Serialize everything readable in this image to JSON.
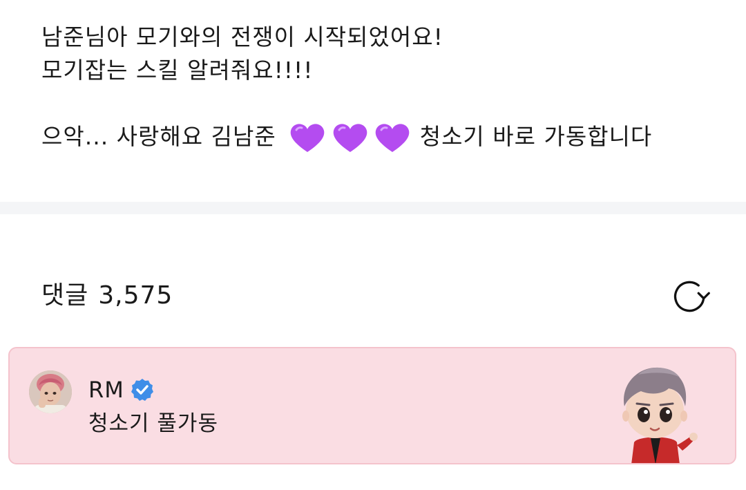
{
  "post": {
    "lines": [
      "남준님아 모기와의 전쟁이 시작되었어요!",
      "모기잡는 스킬 알려줘요!!!!"
    ],
    "line3_before": "으악... 사랑해요 김남준",
    "line3_after": "청소기 바로 가동합니다",
    "hearts_icon": "purple-heart-emoji",
    "hearts_color": "#b44cf0"
  },
  "comments": {
    "label": "댓글",
    "count": "3,575",
    "refresh_icon": "refresh-icon"
  },
  "pinned_comment": {
    "author": "RM",
    "verified_icon": "verified-badge-icon",
    "verified_color": "#3f8ee8",
    "text": "청소기 풀가동",
    "background": "#fadde3",
    "sticker_icon": "character-sticker"
  }
}
